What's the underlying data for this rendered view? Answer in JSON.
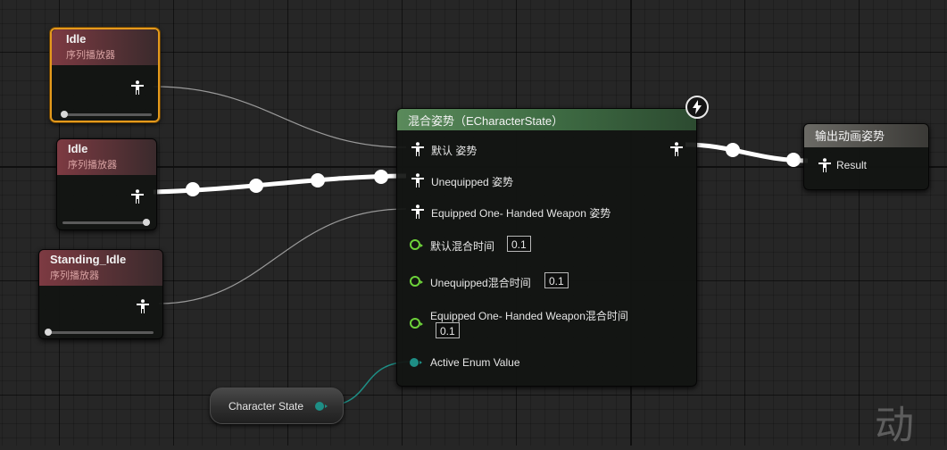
{
  "nodes": {
    "idle_1": {
      "title": "Idle",
      "subtitle": "序列播放器",
      "selected": true
    },
    "idle_2": {
      "title": "Idle",
      "subtitle": "序列播放器",
      "selected": false
    },
    "standing_idle": {
      "title": "Standing_Idle",
      "subtitle": "序列播放器",
      "selected": false
    },
    "blend": {
      "title": "混合姿势（ECharacterState）",
      "pose_pins": [
        {
          "label": "默认 姿势"
        },
        {
          "label": "Unequipped 姿势"
        },
        {
          "label": "Equipped One- Handed Weapon 姿势"
        }
      ],
      "float_pins": [
        {
          "label": "默认混合时间",
          "value": "0.1"
        },
        {
          "label": "Unequipped混合时间",
          "value": "0.1"
        },
        {
          "label": "Equipped One- Handed Weapon混合时间",
          "value": "0.1"
        }
      ],
      "enum_pin": {
        "label": "Active Enum Value"
      }
    },
    "output": {
      "title": "输出动画姿势",
      "pin_label": "Result"
    },
    "variable": {
      "label": "Character State"
    }
  },
  "icons": {
    "pose": "pose-icon",
    "float": "float-pin-icon",
    "enum": "enum-pin-icon",
    "fast_path": "lightning-icon"
  },
  "colors": {
    "selected_border": "#e59a1c",
    "sequence_header": "#7d3a42",
    "blend_header": "#5a8a5b",
    "float_pin": "#6dd23a",
    "enum_pin": "#1e8e85",
    "wire": "#ffffff"
  },
  "watermark": "动"
}
